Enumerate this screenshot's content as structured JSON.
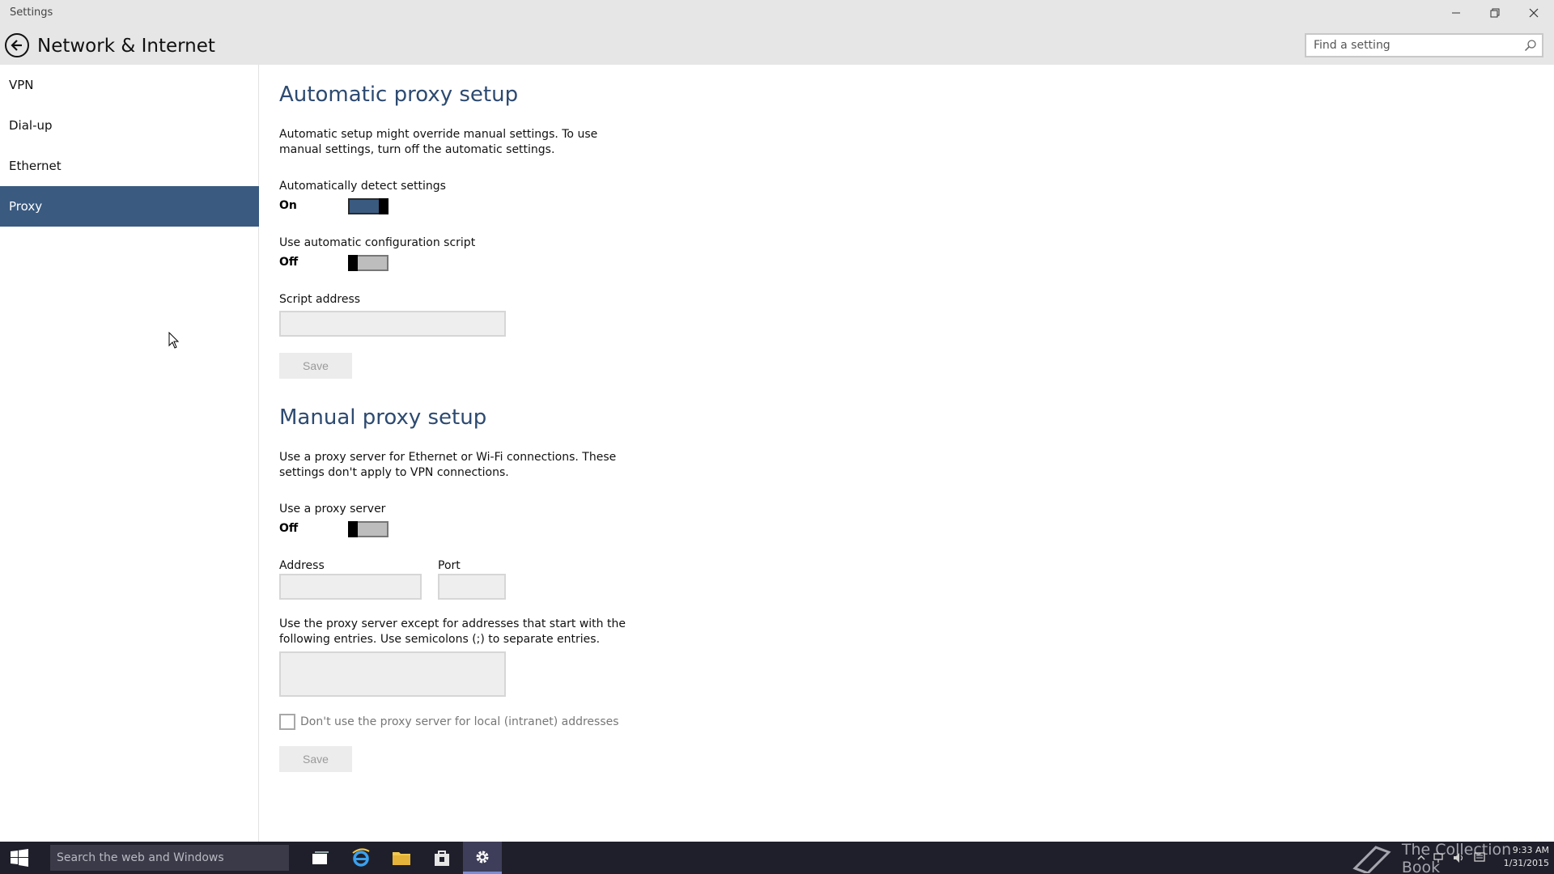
{
  "window": {
    "app_title": "Settings"
  },
  "header": {
    "title": "Network & Internet",
    "search_placeholder": "Find a setting"
  },
  "sidebar": {
    "items": [
      {
        "label": "VPN",
        "selected": false
      },
      {
        "label": "Dial-up",
        "selected": false
      },
      {
        "label": "Ethernet",
        "selected": false
      },
      {
        "label": "Proxy",
        "selected": true
      }
    ]
  },
  "automatic": {
    "heading": "Automatic proxy setup",
    "description": "Automatic setup might override manual settings. To use manual settings, turn off the automatic settings.",
    "detect_label": "Automatically detect settings",
    "detect_state": "On",
    "script_label": "Use automatic configuration script",
    "script_state": "Off",
    "script_address_label": "Script address",
    "script_address_value": "",
    "save_label": "Save"
  },
  "manual": {
    "heading": "Manual proxy setup",
    "description": "Use a proxy server for Ethernet or Wi-Fi connections. These settings don't apply to VPN connections.",
    "use_proxy_label": "Use a proxy server",
    "use_proxy_state": "Off",
    "address_label": "Address",
    "address_value": "",
    "port_label": "Port",
    "port_value": "",
    "exceptions_description": "Use the proxy server except for addresses that start with the following entries. Use semicolons (;) to separate entries.",
    "exceptions_value": "",
    "local_checkbox_label": "Don't use the proxy server for local (intranet) addresses",
    "save_label": "Save"
  },
  "taskbar": {
    "search_placeholder": "Search the web and Windows",
    "watermark": "The Collection Book",
    "time": "9:33 AM",
    "date": "1/31/2015"
  },
  "colors": {
    "accent": "#3a5a80",
    "heading": "#2d4a70",
    "chrome": "#e6e6e6",
    "taskbar": "#1f1f2b"
  }
}
